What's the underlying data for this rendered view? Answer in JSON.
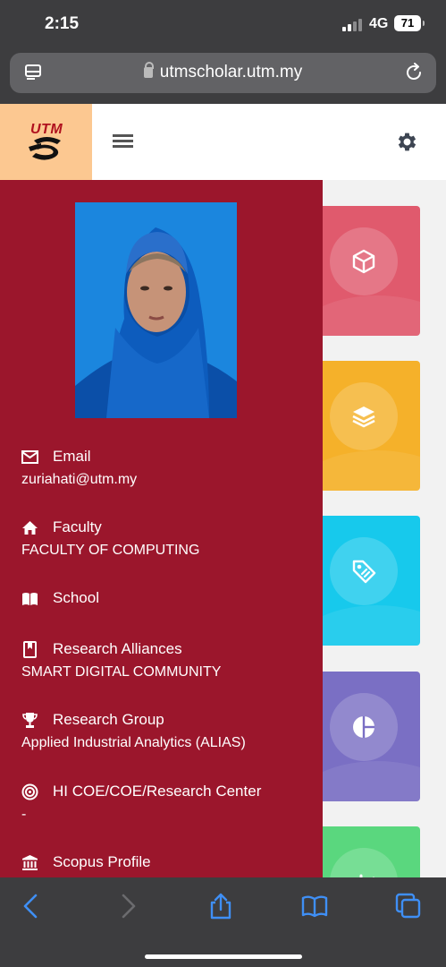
{
  "status": {
    "time": "2:15",
    "network": "4G",
    "battery": "71"
  },
  "browser": {
    "url": "utmscholar.utm.my"
  },
  "brand": {
    "logo_text": "UTM"
  },
  "profile": {
    "fields": [
      {
        "icon": "email-icon",
        "label": "Email",
        "value": "zuriahati@utm.my"
      },
      {
        "icon": "home-icon",
        "label": "Faculty",
        "value": "FACULTY OF COMPUTING"
      },
      {
        "icon": "book-icon",
        "label": "School",
        "value": ""
      },
      {
        "icon": "bookmark-book-icon",
        "label": "Research Alliances",
        "value": "SMART DIGITAL COMMUNITY"
      },
      {
        "icon": "trophy-icon",
        "label": "Research Group",
        "value": "Applied Industrial Analytics (ALIAS)"
      },
      {
        "icon": "target-icon",
        "label": "HI COE/COE/Research Center",
        "value": "-"
      },
      {
        "icon": "bank-icon",
        "label": "Scopus Profile",
        "value": ""
      }
    ]
  },
  "tiles": [
    {
      "icon": "cube-icon",
      "color": "#e05a6d"
    },
    {
      "icon": "layers-icon",
      "color": "#f5b12a"
    },
    {
      "icon": "tag-icon",
      "color": "#17c9ec"
    },
    {
      "icon": "pie-chart-icon",
      "color": "#7a6fc4"
    },
    {
      "icon": "bar-chart-icon",
      "color": "#5ad77e"
    }
  ],
  "colors": {
    "sidebar": "#9b162c",
    "logo_bg": "#fcc891"
  }
}
